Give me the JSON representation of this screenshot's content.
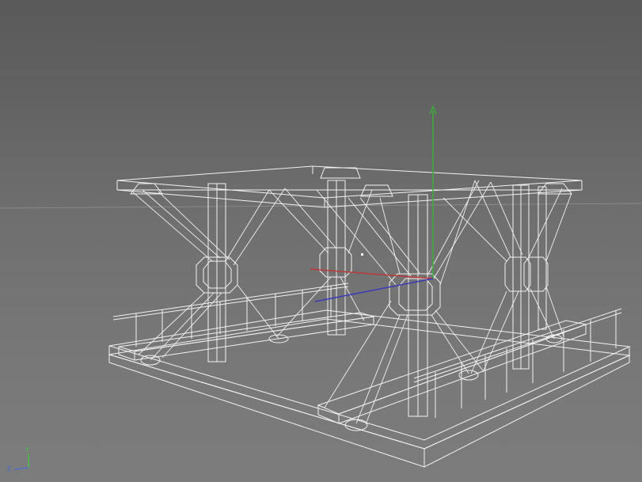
{
  "viewport": {
    "mode": "wireframe",
    "background_color": "#6e6e6e",
    "wire_color": "#f2f2f2",
    "horizon_color": "#8a8a8a",
    "center_dot_color": "#ffffff"
  },
  "gizmo": {
    "x_color": "#b83a3a",
    "y_color": "#3ab03a",
    "z_color": "#3a3ab8"
  },
  "axis_indicator": {
    "y_label": "Y",
    "z_label": "Z",
    "y_color": "#3ccf3c",
    "z_color": "#4a6bd6"
  }
}
